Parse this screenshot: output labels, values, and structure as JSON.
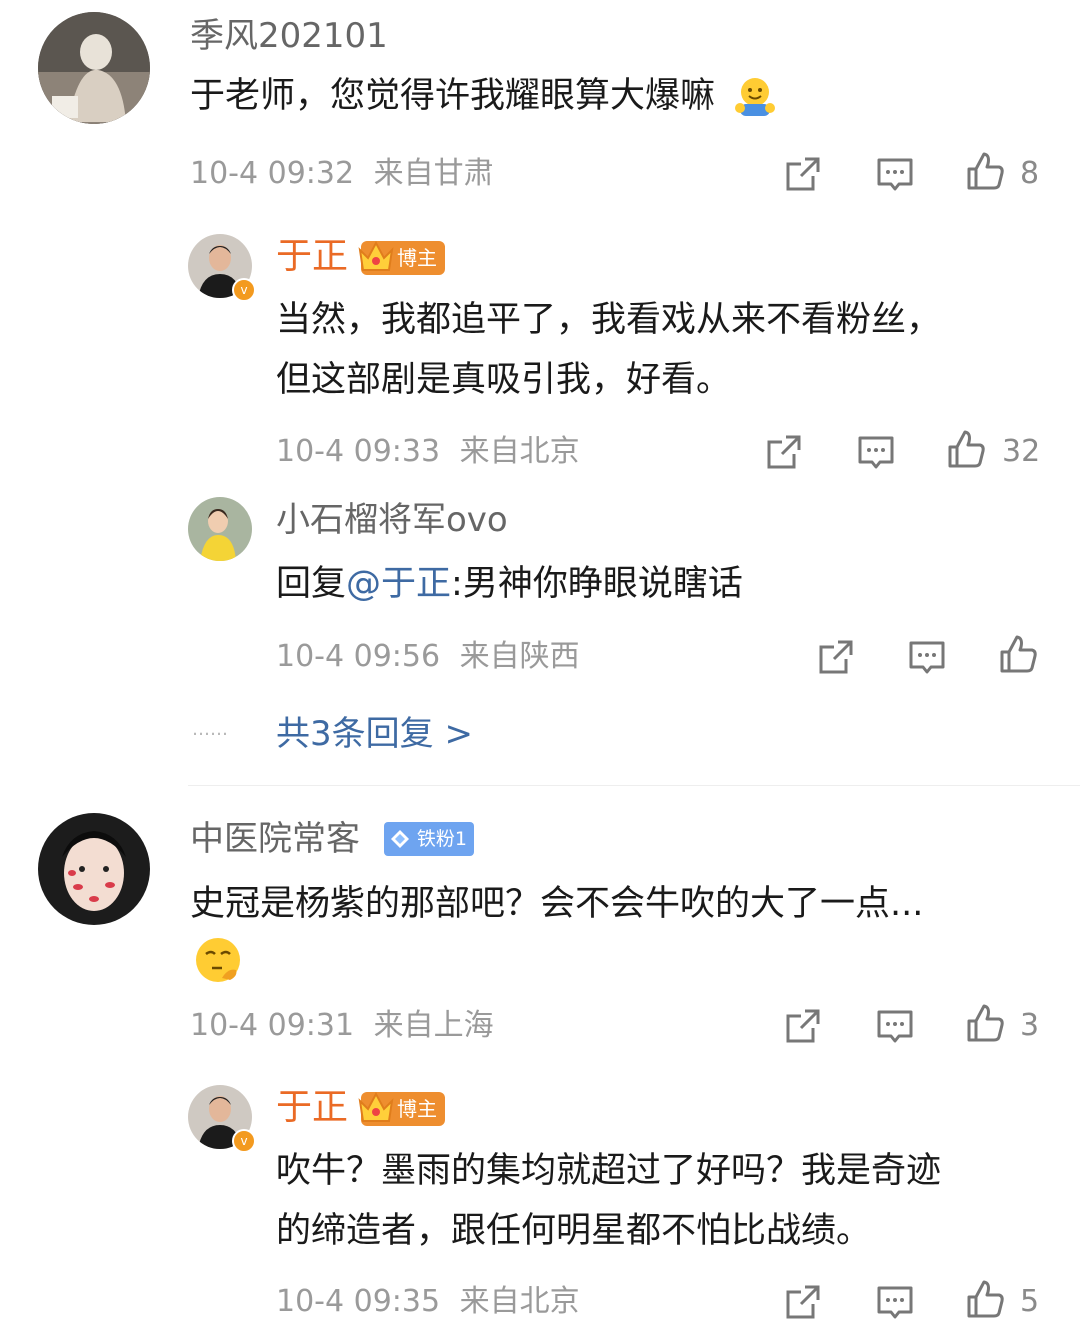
{
  "comments": [
    {
      "username": "季风202101",
      "text": "于老师，您觉得许我耀眼算大爆嘛",
      "emoji": "hug-emoji",
      "time": "10-4 09:32",
      "location": "来自甘肃",
      "likes": "8",
      "replies": [
        {
          "username": "于正",
          "badge": "博主",
          "text_lines": [
            "当然，我都追平了，我看戏从来不看粉丝，",
            "但这部剧是真吸引我，好看。"
          ],
          "time": "10-4 09:33",
          "location": "来自北京",
          "likes": "32"
        },
        {
          "username": "小石榴将军ovo",
          "text_prefix": "回复",
          "mention": "@于正",
          "text_suffix": ":男神你睁眼说瞎话",
          "time": "10-4 09:56",
          "location": "来自陕西",
          "likes": ""
        }
      ],
      "more_replies": "共3条回复 >",
      "more_dots": "……"
    },
    {
      "username": "中医院常客",
      "badge": "铁粉1",
      "text": "史冠是杨紫的那部吧？会不会牛吹的大了一点...",
      "emoji": "thinking-emoji",
      "time": "10-4 09:31",
      "location": "来自上海",
      "likes": "3",
      "replies": [
        {
          "username": "于正",
          "badge": "博主",
          "text_lines": [
            "吹牛？墨雨的集均就超过了好吗？我是奇迹",
            "的缔造者，跟任何明星都不怕比战绩。"
          ],
          "time": "10-4 09:35",
          "location": "来自北京",
          "likes": "5"
        }
      ]
    }
  ],
  "colors": {
    "reply_name": "#ea6a25",
    "link": "#3e6aa3",
    "meta": "#9a9a9a"
  }
}
